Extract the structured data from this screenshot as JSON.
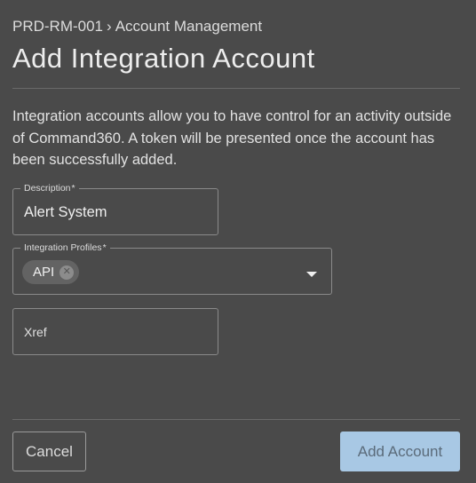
{
  "breadcrumb": {
    "parent": "PRD-RM-001",
    "separator": "›",
    "current": "Account Management"
  },
  "title": "Add Integration Account",
  "description": "Integration accounts allow you to have control for an activity outside of Command360. A token will be presented once the account has been successfully added.",
  "form": {
    "description_field": {
      "label": "Description",
      "required_mark": "*",
      "value": "Alert System"
    },
    "profiles_field": {
      "label": "Integration Profiles",
      "required_mark": "*",
      "chips": [
        {
          "label": "API",
          "remove_icon": "close-circle-icon"
        }
      ],
      "dropdown_icon": "caret-down-icon"
    },
    "xref_field": {
      "placeholder": "Xref",
      "value": ""
    }
  },
  "actions": {
    "cancel_label": "Cancel",
    "submit_label": "Add Account"
  },
  "colors": {
    "background": "#4a4a4a",
    "primary_button": "#a8c8e4",
    "primary_button_text": "#5b6b7a",
    "field_border": "#8a8a8a"
  }
}
